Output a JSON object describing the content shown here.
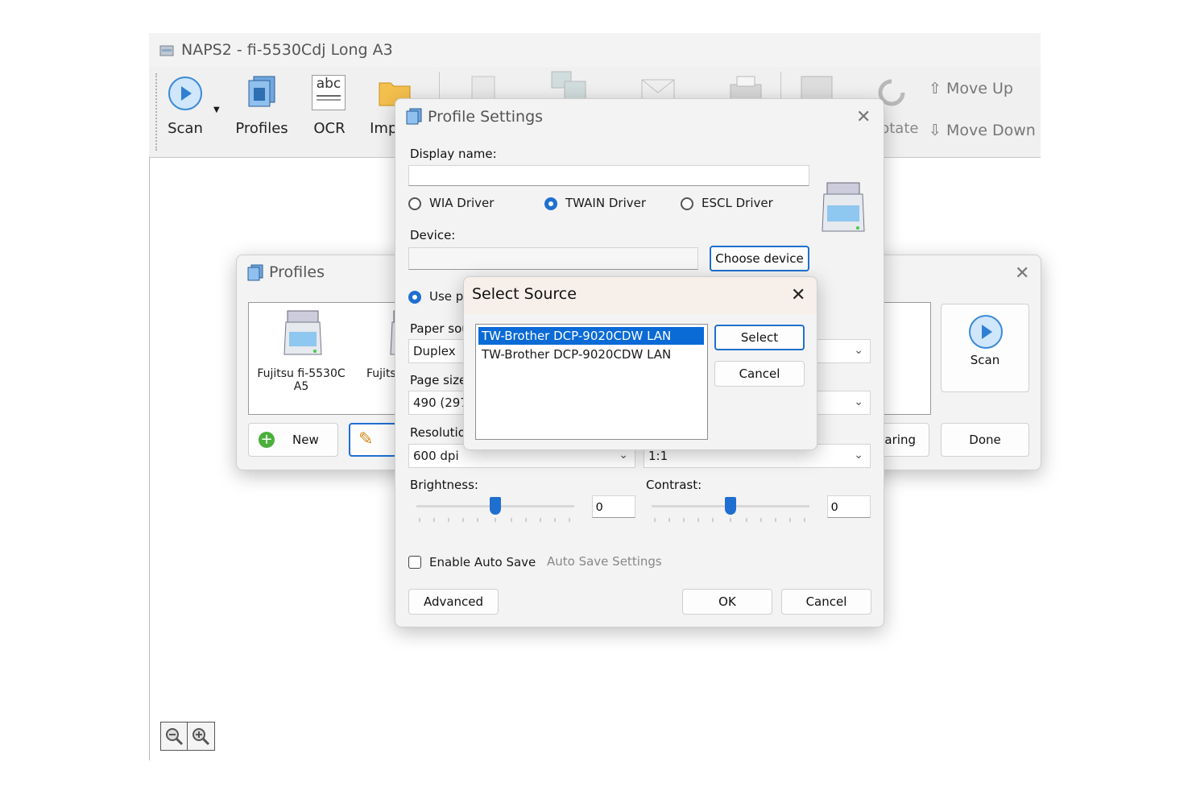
{
  "main_window": {
    "title": "NAPS2 - fi-5530Cdj Long A3",
    "toolbar": {
      "scan": "Scan",
      "profiles": "Profiles",
      "ocr": "OCR",
      "import": "Import",
      "rotate": "Rotate",
      "move_up": "Move Up",
      "move_down": "Move Down"
    },
    "ocr_icon_text": "abc"
  },
  "profiles_dialog": {
    "title": "Profiles",
    "items": [
      {
        "label": "Fujitsu fi-5530C A5"
      },
      {
        "label": "Fujitsu"
      }
    ],
    "new_button": "New",
    "sharing_button": "Sharing",
    "done_button": "Done",
    "scan_button": "Scan"
  },
  "profile_settings": {
    "title": "Profile Settings",
    "display_name_label": "Display name:",
    "display_name_value": "",
    "drivers": [
      {
        "label": "WIA Driver",
        "selected": false
      },
      {
        "label": "TWAIN Driver",
        "selected": true
      },
      {
        "label": "ESCL Driver",
        "selected": false
      }
    ],
    "device_label": "Device:",
    "device_value": "",
    "choose_device_button": "Choose device",
    "use_predefined_label": "Use predefined settings",
    "paper_source_label": "Paper source:",
    "paper_source_value": "Duplex",
    "page_size_label": "Page size:",
    "page_size_value": "490 (297x420 mm)",
    "resolution_label": "Resolution:",
    "resolution_value": "600 dpi",
    "scale_value": "1:1",
    "brightness_label": "Brightness:",
    "brightness_value": "0",
    "brightness_level": 0.5,
    "contrast_label": "Contrast:",
    "contrast_value": "0",
    "contrast_level": 0.5,
    "auto_save_label": "Enable Auto Save",
    "auto_save_checked": false,
    "auto_save_settings_link": "Auto Save Settings",
    "advanced_button": "Advanced",
    "ok_button": "OK",
    "cancel_button": "Cancel"
  },
  "select_source": {
    "title": "Select Source",
    "sources": [
      {
        "label": "TW-Brother DCP-9020CDW LAN",
        "selected": true
      },
      {
        "label": "TW-Brother DCP-9020CDW LAN",
        "selected": false
      }
    ],
    "select_button": "Select",
    "cancel_button": "Cancel"
  },
  "colors": {
    "accent": "#1f6fd0",
    "selection": "#0a6ad6"
  }
}
